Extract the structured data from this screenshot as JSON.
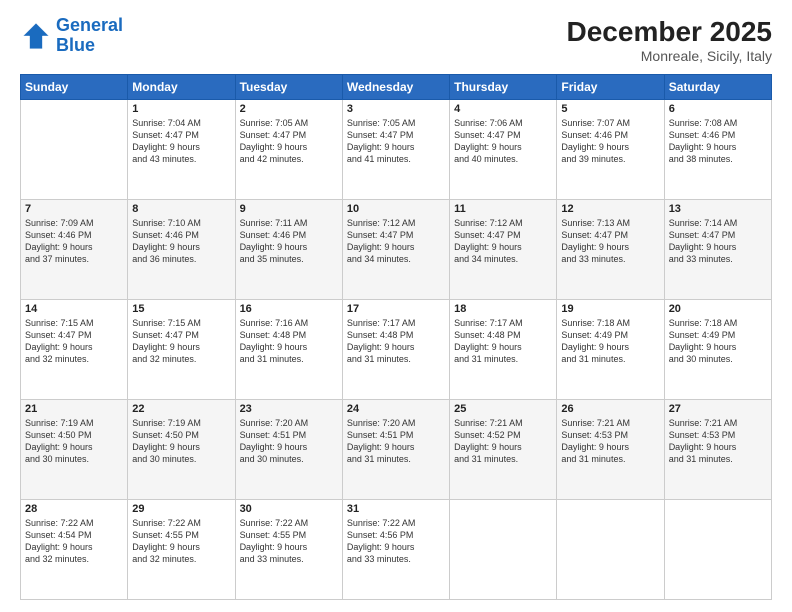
{
  "header": {
    "logo_line1": "General",
    "logo_line2": "Blue",
    "month": "December 2025",
    "location": "Monreale, Sicily, Italy"
  },
  "weekdays": [
    "Sunday",
    "Monday",
    "Tuesday",
    "Wednesday",
    "Thursday",
    "Friday",
    "Saturday"
  ],
  "weeks": [
    [
      {
        "day": "",
        "info": ""
      },
      {
        "day": "1",
        "info": "Sunrise: 7:04 AM\nSunset: 4:47 PM\nDaylight: 9 hours\nand 43 minutes."
      },
      {
        "day": "2",
        "info": "Sunrise: 7:05 AM\nSunset: 4:47 PM\nDaylight: 9 hours\nand 42 minutes."
      },
      {
        "day": "3",
        "info": "Sunrise: 7:05 AM\nSunset: 4:47 PM\nDaylight: 9 hours\nand 41 minutes."
      },
      {
        "day": "4",
        "info": "Sunrise: 7:06 AM\nSunset: 4:47 PM\nDaylight: 9 hours\nand 40 minutes."
      },
      {
        "day": "5",
        "info": "Sunrise: 7:07 AM\nSunset: 4:46 PM\nDaylight: 9 hours\nand 39 minutes."
      },
      {
        "day": "6",
        "info": "Sunrise: 7:08 AM\nSunset: 4:46 PM\nDaylight: 9 hours\nand 38 minutes."
      }
    ],
    [
      {
        "day": "7",
        "info": "Sunrise: 7:09 AM\nSunset: 4:46 PM\nDaylight: 9 hours\nand 37 minutes."
      },
      {
        "day": "8",
        "info": "Sunrise: 7:10 AM\nSunset: 4:46 PM\nDaylight: 9 hours\nand 36 minutes."
      },
      {
        "day": "9",
        "info": "Sunrise: 7:11 AM\nSunset: 4:46 PM\nDaylight: 9 hours\nand 35 minutes."
      },
      {
        "day": "10",
        "info": "Sunrise: 7:12 AM\nSunset: 4:47 PM\nDaylight: 9 hours\nand 34 minutes."
      },
      {
        "day": "11",
        "info": "Sunrise: 7:12 AM\nSunset: 4:47 PM\nDaylight: 9 hours\nand 34 minutes."
      },
      {
        "day": "12",
        "info": "Sunrise: 7:13 AM\nSunset: 4:47 PM\nDaylight: 9 hours\nand 33 minutes."
      },
      {
        "day": "13",
        "info": "Sunrise: 7:14 AM\nSunset: 4:47 PM\nDaylight: 9 hours\nand 33 minutes."
      }
    ],
    [
      {
        "day": "14",
        "info": "Sunrise: 7:15 AM\nSunset: 4:47 PM\nDaylight: 9 hours\nand 32 minutes."
      },
      {
        "day": "15",
        "info": "Sunrise: 7:15 AM\nSunset: 4:47 PM\nDaylight: 9 hours\nand 32 minutes."
      },
      {
        "day": "16",
        "info": "Sunrise: 7:16 AM\nSunset: 4:48 PM\nDaylight: 9 hours\nand 31 minutes."
      },
      {
        "day": "17",
        "info": "Sunrise: 7:17 AM\nSunset: 4:48 PM\nDaylight: 9 hours\nand 31 minutes."
      },
      {
        "day": "18",
        "info": "Sunrise: 7:17 AM\nSunset: 4:48 PM\nDaylight: 9 hours\nand 31 minutes."
      },
      {
        "day": "19",
        "info": "Sunrise: 7:18 AM\nSunset: 4:49 PM\nDaylight: 9 hours\nand 31 minutes."
      },
      {
        "day": "20",
        "info": "Sunrise: 7:18 AM\nSunset: 4:49 PM\nDaylight: 9 hours\nand 30 minutes."
      }
    ],
    [
      {
        "day": "21",
        "info": "Sunrise: 7:19 AM\nSunset: 4:50 PM\nDaylight: 9 hours\nand 30 minutes."
      },
      {
        "day": "22",
        "info": "Sunrise: 7:19 AM\nSunset: 4:50 PM\nDaylight: 9 hours\nand 30 minutes."
      },
      {
        "day": "23",
        "info": "Sunrise: 7:20 AM\nSunset: 4:51 PM\nDaylight: 9 hours\nand 30 minutes."
      },
      {
        "day": "24",
        "info": "Sunrise: 7:20 AM\nSunset: 4:51 PM\nDaylight: 9 hours\nand 31 minutes."
      },
      {
        "day": "25",
        "info": "Sunrise: 7:21 AM\nSunset: 4:52 PM\nDaylight: 9 hours\nand 31 minutes."
      },
      {
        "day": "26",
        "info": "Sunrise: 7:21 AM\nSunset: 4:53 PM\nDaylight: 9 hours\nand 31 minutes."
      },
      {
        "day": "27",
        "info": "Sunrise: 7:21 AM\nSunset: 4:53 PM\nDaylight: 9 hours\nand 31 minutes."
      }
    ],
    [
      {
        "day": "28",
        "info": "Sunrise: 7:22 AM\nSunset: 4:54 PM\nDaylight: 9 hours\nand 32 minutes."
      },
      {
        "day": "29",
        "info": "Sunrise: 7:22 AM\nSunset: 4:55 PM\nDaylight: 9 hours\nand 32 minutes."
      },
      {
        "day": "30",
        "info": "Sunrise: 7:22 AM\nSunset: 4:55 PM\nDaylight: 9 hours\nand 33 minutes."
      },
      {
        "day": "31",
        "info": "Sunrise: 7:22 AM\nSunset: 4:56 PM\nDaylight: 9 hours\nand 33 minutes."
      },
      {
        "day": "",
        "info": ""
      },
      {
        "day": "",
        "info": ""
      },
      {
        "day": "",
        "info": ""
      }
    ]
  ]
}
